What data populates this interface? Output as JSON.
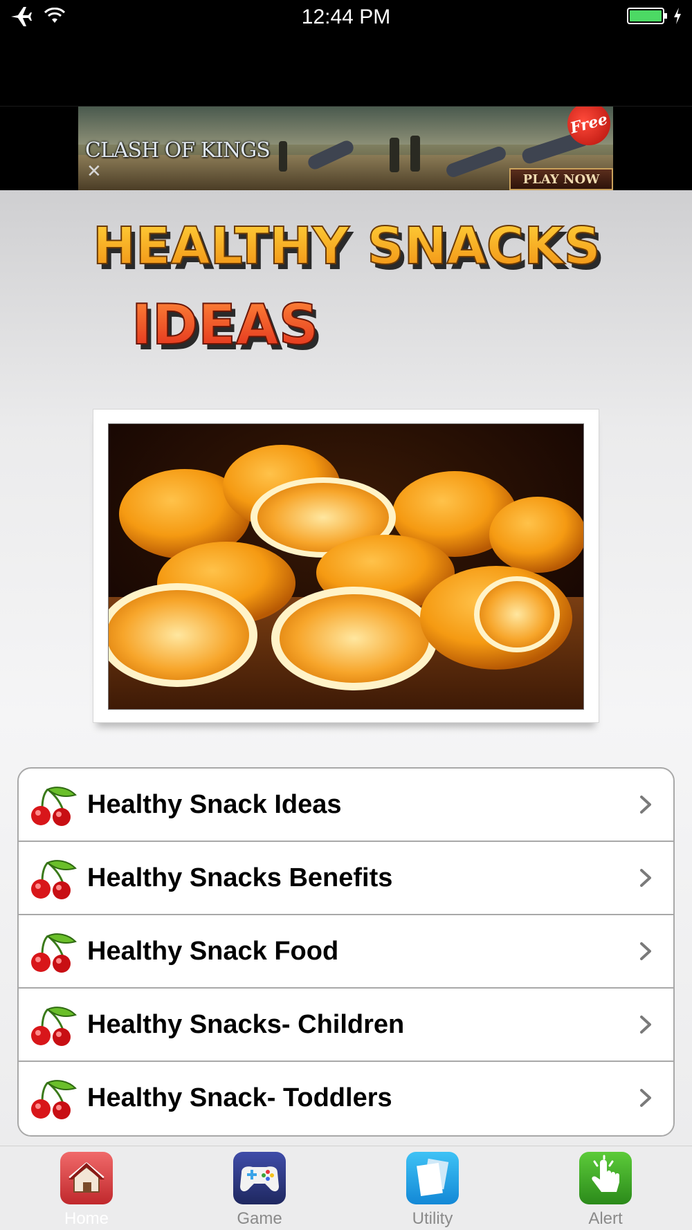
{
  "status_bar": {
    "time": "12:44 PM",
    "left_icons": [
      "airplane-icon",
      "wifi-icon"
    ],
    "right_icons": [
      "battery-icon",
      "charging-icon"
    ]
  },
  "ad": {
    "logo_text": "CLASH OF KINGS",
    "badge_text": "Free",
    "cta_label": "PLAY NOW",
    "close_label": "✕"
  },
  "header": {
    "title_line1": "HEALTHY SNACKS",
    "title_line2": "IDEAS",
    "title_colors": {
      "line1": "#f7b316",
      "line2": "#ef4a23"
    }
  },
  "hero_image": {
    "subject": "oranges"
  },
  "menu": {
    "items": [
      {
        "label": "Healthy Snack Ideas",
        "icon": "cherry-icon"
      },
      {
        "label": "Healthy Snacks Benefits",
        "icon": "cherry-icon"
      },
      {
        "label": "Healthy Snack Food",
        "icon": "cherry-icon"
      },
      {
        "label": "Healthy Snacks- Children",
        "icon": "cherry-icon"
      },
      {
        "label": "Healthy Snack- Toddlers",
        "icon": "cherry-icon"
      }
    ]
  },
  "tab_bar": {
    "tabs": [
      {
        "label": "Home",
        "icon": "home-icon",
        "active": true,
        "color": "#d94b4f"
      },
      {
        "label": "Game",
        "icon": "gamepad-icon",
        "active": false,
        "color": "#2f3b8a"
      },
      {
        "label": "Utility",
        "icon": "documents-icon",
        "active": false,
        "color": "#1fa0e8"
      },
      {
        "label": "Alert",
        "icon": "pointing-hand-icon",
        "active": false,
        "color": "#3fae2a"
      }
    ]
  }
}
